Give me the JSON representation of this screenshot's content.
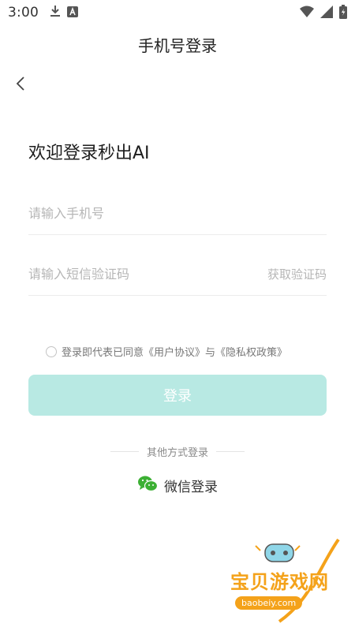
{
  "status_bar": {
    "time": "3:00"
  },
  "header": {
    "title": "手机号登录"
  },
  "welcome": "欢迎登录秒出AI",
  "form": {
    "phone_placeholder": "请输入手机号",
    "code_placeholder": "请输入短信验证码",
    "get_code_label": "获取验证码"
  },
  "agreement": {
    "text": "登录即代表已同意《用户协议》与《隐私权政策》"
  },
  "login_button": "登录",
  "other_methods": {
    "label": "其他方式登录",
    "wechat_label": "微信登录"
  },
  "watermark": {
    "text": "宝贝游戏网",
    "url": "baobeiy.com"
  },
  "colors": {
    "accent_disabled": "#b8e9e3",
    "wechat": "#3cb034",
    "watermark": "#f4a21a"
  },
  "icons": [
    "download-icon",
    "notification-a-icon",
    "wifi-icon",
    "signal-icon",
    "battery-icon",
    "back-arrow-icon",
    "wechat-icon"
  ]
}
